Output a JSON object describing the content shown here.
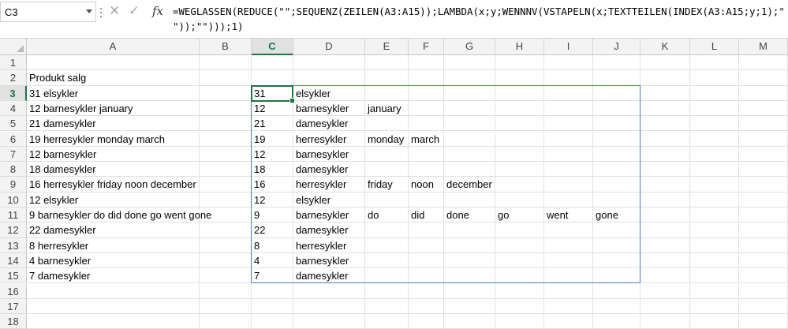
{
  "namebox": {
    "value": "C3"
  },
  "formula_bar": {
    "fx_label": "fx",
    "formula": "=WEGLASSEN(REDUCE(\"\";SEQUENZ(ZEILEN(A3:A15));LAMBDA(x;y;WENNNV(VSTAPELN(x;TEXTTEILEN(INDEX(A3:A15;y;1);\" \"));\"\")));1)"
  },
  "columns": [
    "A",
    "B",
    "C",
    "D",
    "E",
    "F",
    "G",
    "H",
    "I",
    "J",
    "K",
    "L",
    "M"
  ],
  "selected_column": "C",
  "selected_row": "3",
  "rows": [
    "1",
    "2",
    "3",
    "4",
    "5",
    "6",
    "7",
    "8",
    "9",
    "10",
    "11",
    "12",
    "13",
    "14",
    "15",
    "16",
    "17",
    "18"
  ],
  "cells": {
    "A2": "Produkt salg",
    "A3": "31 elsykler",
    "A4": "12 barnesykler january",
    "A5": "21 damesykler",
    "A6": "19 herresykler monday march",
    "A7": "12 barnesykler",
    "A8": "18 damesykler",
    "A9": "16 herresykler friday noon december",
    "A10": "12 elsykler",
    "A11": "9 barnesykler do did done go went gone",
    "A12": "22 damesykler",
    "A13": "8 herresykler",
    "A14": "4 barnesykler",
    "A15": "7 damesykler",
    "C3": "31",
    "D3": "elsykler",
    "C4": "12",
    "D4": "barnesykler",
    "E4": "january",
    "C5": "21",
    "D5": "damesykler",
    "C6": "19",
    "D6": "herresykler",
    "E6": "monday",
    "F6": "march",
    "C7": "12",
    "D7": "barnesykler",
    "C8": "18",
    "D8": "damesykler",
    "C9": "16",
    "D9": "herresykler",
    "E9": "friday",
    "F9": "noon",
    "G9": "december",
    "C10": "12",
    "D10": "elsykler",
    "C11": "9",
    "D11": "barnesykler",
    "E11": "do",
    "F11": "did",
    "G11": "done",
    "H11": "go",
    "I11": "went",
    "J11": "gone",
    "C12": "22",
    "D12": "damesykler",
    "C13": "8",
    "D13": "herresykler",
    "C14": "4",
    "D14": "barnesykler",
    "C15": "7",
    "D15": "damesykler"
  },
  "colors": {
    "selection": "#217346",
    "spill_border": "#4a7cc0",
    "header_bg": "#f3f3f3"
  }
}
